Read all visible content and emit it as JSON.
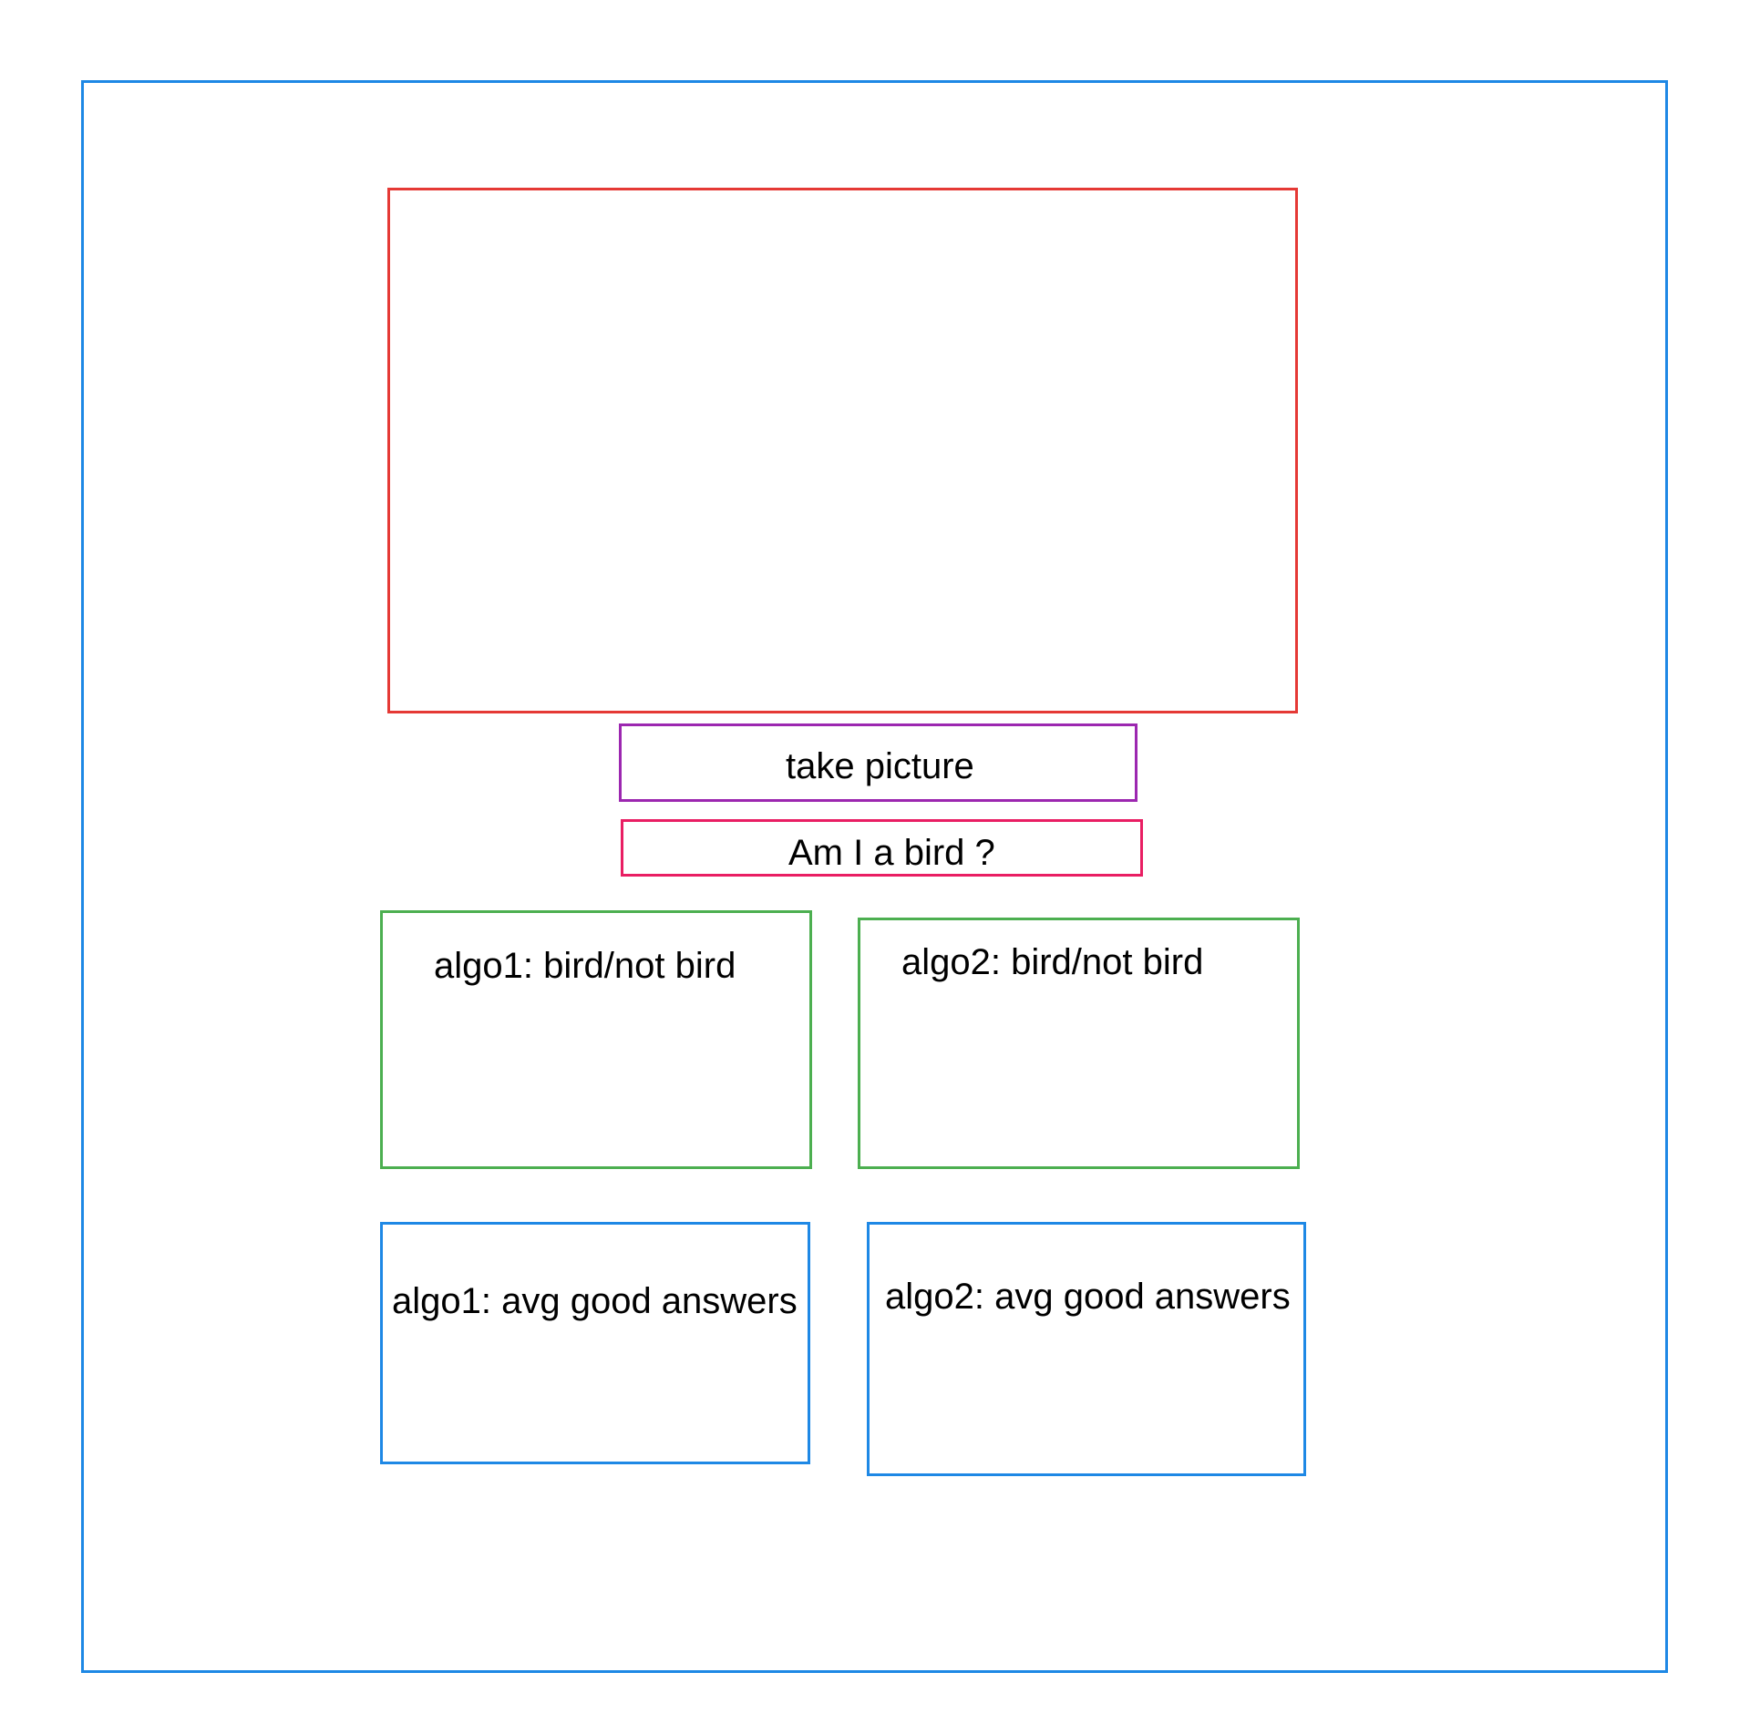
{
  "app": {
    "buttons": {
      "take_picture": "take picture",
      "am_i_a_bird": "Am I a bird ?"
    },
    "results": {
      "algo1_label": "algo1: bird/not bird",
      "algo2_label": "algo2: bird/not bird"
    },
    "stats": {
      "algo1_label": "algo1: avg good answers",
      "algo2_label": "algo2: avg good answers"
    }
  },
  "colors": {
    "frame": "#1e88e5",
    "camera_preview": "#e53935",
    "take_picture_button": "#9c27b0",
    "bird_question_button": "#e91e63",
    "result_boxes": "#4caf50",
    "stat_boxes": "#1e88e5"
  }
}
